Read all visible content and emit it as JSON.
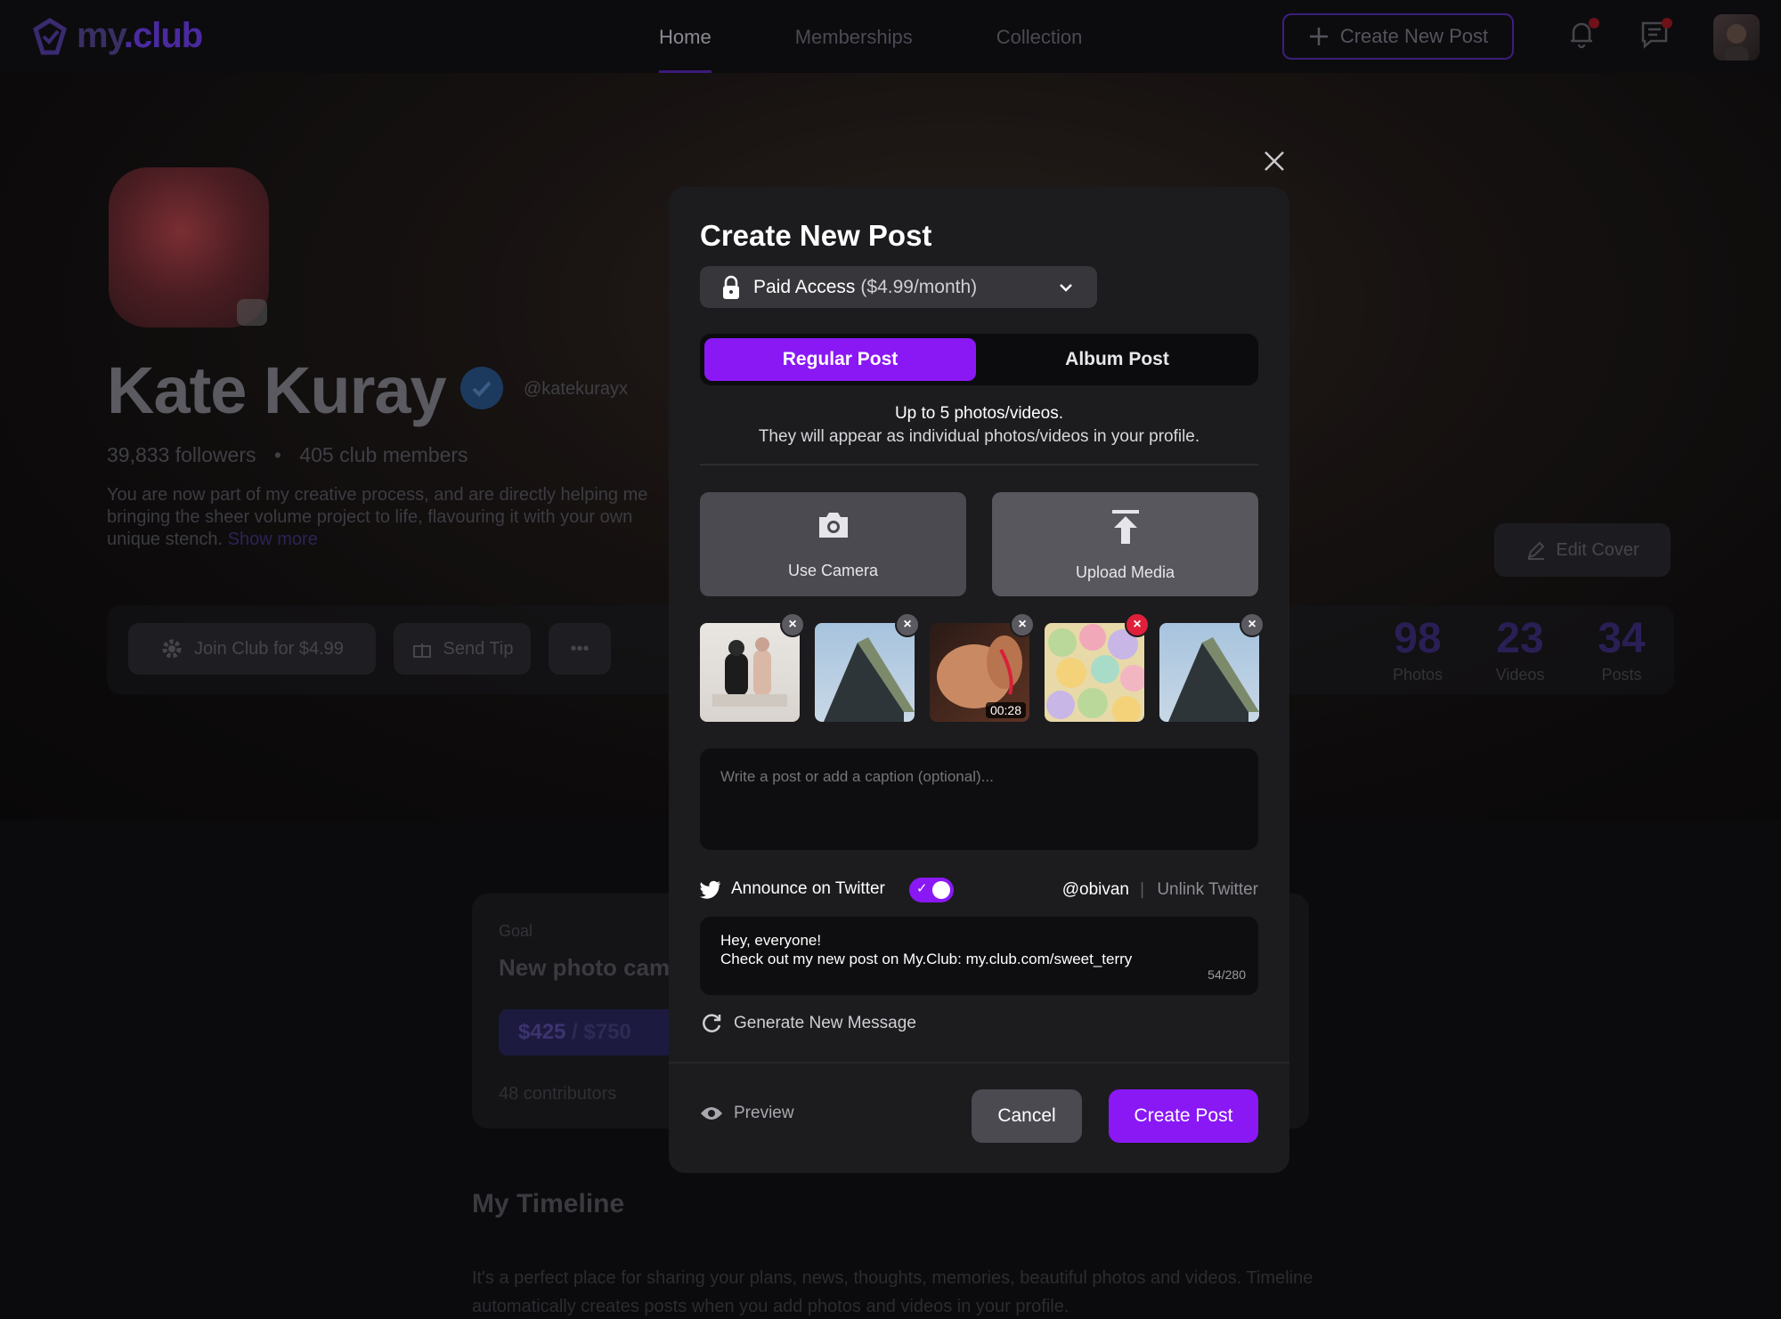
{
  "nav": {
    "logo": {
      "name": "my",
      "dot": ".club"
    },
    "tabs": [
      {
        "label": "Home",
        "active": true
      },
      {
        "label": "Memberships",
        "active": false
      },
      {
        "label": "Collection",
        "active": false
      }
    ],
    "create_label": "Create New Post",
    "icons": [
      "bell-icon",
      "chat-icon"
    ]
  },
  "profile": {
    "name": "Kate Kuray",
    "handle": "@katekurayx",
    "followers": "39,833 followers",
    "separator": "•",
    "members": "405 club members",
    "bio": "You are now part of my creative process, and are directly helping me bringing the sheer volume project to life, flavouring it with your own unique stench.",
    "show_more": "Show more",
    "join_label": "Join Club for $4.99",
    "tip_label": "Send Tip",
    "more_label": "•••",
    "edit_cover": "Edit Cover",
    "stats": [
      {
        "value": "98",
        "label": "Photos"
      },
      {
        "value": "23",
        "label": "Videos"
      },
      {
        "value": "34",
        "label": "Posts"
      }
    ],
    "goal": {
      "label": "Goal",
      "title": "New photo cam",
      "amount": "$425",
      "divider": " / ",
      "target": "$750",
      "contributors": "48 contributors"
    },
    "timeline": {
      "title": "My Timeline",
      "text": "It's a perfect place for sharing your plans, news, thoughts, memories, beautiful photos and videos. Timeline automatically creates posts when you add photos and videos in your profile."
    }
  },
  "modal": {
    "title": "Create New Post",
    "access": {
      "label": "Paid Access",
      "price": "($4.99/month)"
    },
    "tabs": [
      {
        "label": "Regular Post",
        "active": true
      },
      {
        "label": "Album Post",
        "active": false
      }
    ],
    "info_line1": "Up to 5 photos/videos.",
    "info_line2": "They will appear as individual photos/videos in your profile.",
    "use_camera": "Use Camera",
    "upload_media": "Upload Media",
    "thumbnails": [
      {
        "kind": "photo",
        "duration": ""
      },
      {
        "kind": "photo",
        "duration": ""
      },
      {
        "kind": "video",
        "duration": "00:28"
      },
      {
        "kind": "photo",
        "duration": ""
      },
      {
        "kind": "photo",
        "duration": ""
      }
    ],
    "caption_placeholder": "Write a post or add a caption (optional)...",
    "twitter": {
      "label": "Announce on Twitter",
      "enabled": true,
      "user": "@obivan",
      "pipe": "|",
      "unlink": "Unlink Twitter",
      "message_line1": "Hey, everyone!",
      "message_line2": "Check out my new post on My.Club: my.club.com/sweet_terry",
      "counter": "54/280",
      "generate": "Generate New Message"
    },
    "preview": "Preview",
    "cancel": "Cancel",
    "create": "Create Post"
  },
  "colors": {
    "accent": "#8a18f5",
    "modal_bg": "#1c1c1f",
    "remove_red": "#e0203a"
  }
}
